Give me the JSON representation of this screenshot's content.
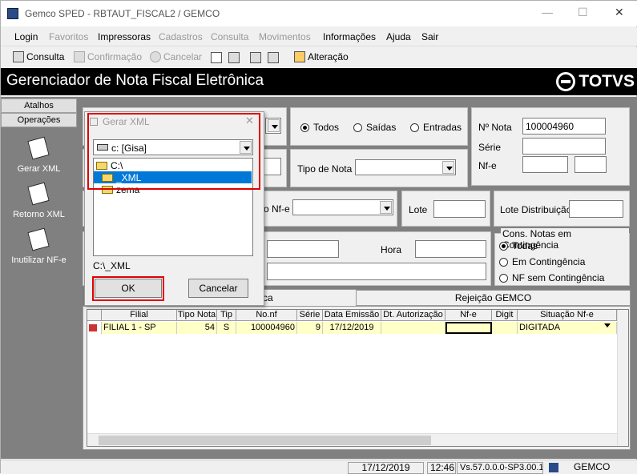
{
  "window": {
    "title": "Gemco SPED - RBTAUT_FISCAL2 / GEMCO",
    "minimize": "—",
    "maximize": "☐",
    "close": "✕"
  },
  "menu": [
    "Login",
    "Favoritos",
    "Impressoras",
    "Cadastros",
    "Consulta",
    "Movimentos",
    "Informações",
    "Ajuda",
    "Sair"
  ],
  "toolbar": {
    "consulta": "Consulta",
    "confirmacao": "Confirmação",
    "cancelar": "Cancelar",
    "alteracao": "Alteração"
  },
  "header": {
    "title": "Gerenciador de Nota Fiscal Eletrônica",
    "logo": "TOTVS"
  },
  "sidebar": {
    "tab_atalhos": "Atalhos",
    "tab_operacoes": "Operações",
    "items": [
      "Gerar XML",
      "Retorno XML",
      "Inutilizar NF-e"
    ]
  },
  "filters": {
    "radio_todos": "Todos",
    "radio_saidas": "Saídas",
    "radio_entradas": "Entradas",
    "nota_label": "Nº Nota",
    "nota_value": "100004960",
    "serie_label": "Série",
    "nfe_label": "Nf-e",
    "tipo_nota_label": "Tipo de Nota",
    "nfe_partial_label": "o Nf-e",
    "lote_label": "Lote",
    "lote_dist_label": "Lote Distribuição",
    "hora_label": "Hora",
    "contingencia_title": "Cons. Notas em Contingência",
    "cont_todas": "Todas",
    "cont_em": "Em Contingência",
    "cont_sem": "NF sem Contingência"
  },
  "tabs": {
    "tab1_partial": "ca",
    "tab2": "Rejeição GEMCO"
  },
  "grid": {
    "headers": [
      "Filial",
      "Tipo Nota",
      "Tip",
      "No.nf",
      "Série",
      "Data Emissão",
      "Dt. Autorização",
      "Nf-e",
      "Digit",
      "Situação Nf-e"
    ],
    "row": {
      "filial": "FILIAL 1 - SP",
      "tipo": "54",
      "tip": "S",
      "nonf": "100004960",
      "serie": "9",
      "emissao": "17/12/2019",
      "autorizacao": "",
      "nfe": "",
      "digit": "",
      "situacao": "DIGITADA"
    }
  },
  "dialog": {
    "title": "Gerar XML",
    "drive": "c: [Gisa]",
    "folders": [
      "C:\\",
      "_XML",
      "zema"
    ],
    "path": "C:\\_XML",
    "ok": "OK",
    "cancel": "Cancelar"
  },
  "status": {
    "date": "17/12/2019",
    "time": "12:46",
    "version": "Vs.57.0.0.0-SP3.00.1",
    "company": "GEMCO"
  }
}
